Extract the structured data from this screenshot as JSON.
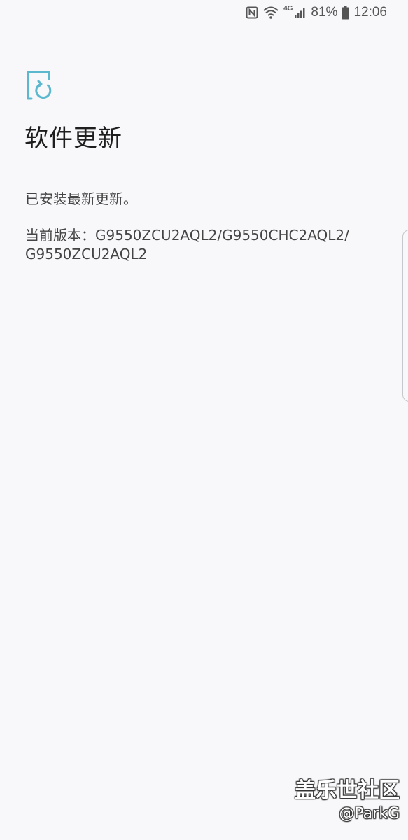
{
  "status_bar": {
    "network_type": "4G",
    "battery_percent": "81%",
    "time": "12:06",
    "icons": [
      "nfc-icon",
      "wifi-icon",
      "signal-icon",
      "battery-icon"
    ]
  },
  "header": {
    "icon": "software-update-icon",
    "icon_color": "#5bb8cf",
    "title": "软件更新"
  },
  "content": {
    "status_message": "已安装最新更新。",
    "version_line1": "当前版本：G9550ZCU2AQL2/G9550CHC2AQL2/",
    "version_line2": "G9550ZCU2AQL2"
  },
  "watermark": {
    "site": "盖乐世社区",
    "user": "@ParkG"
  }
}
